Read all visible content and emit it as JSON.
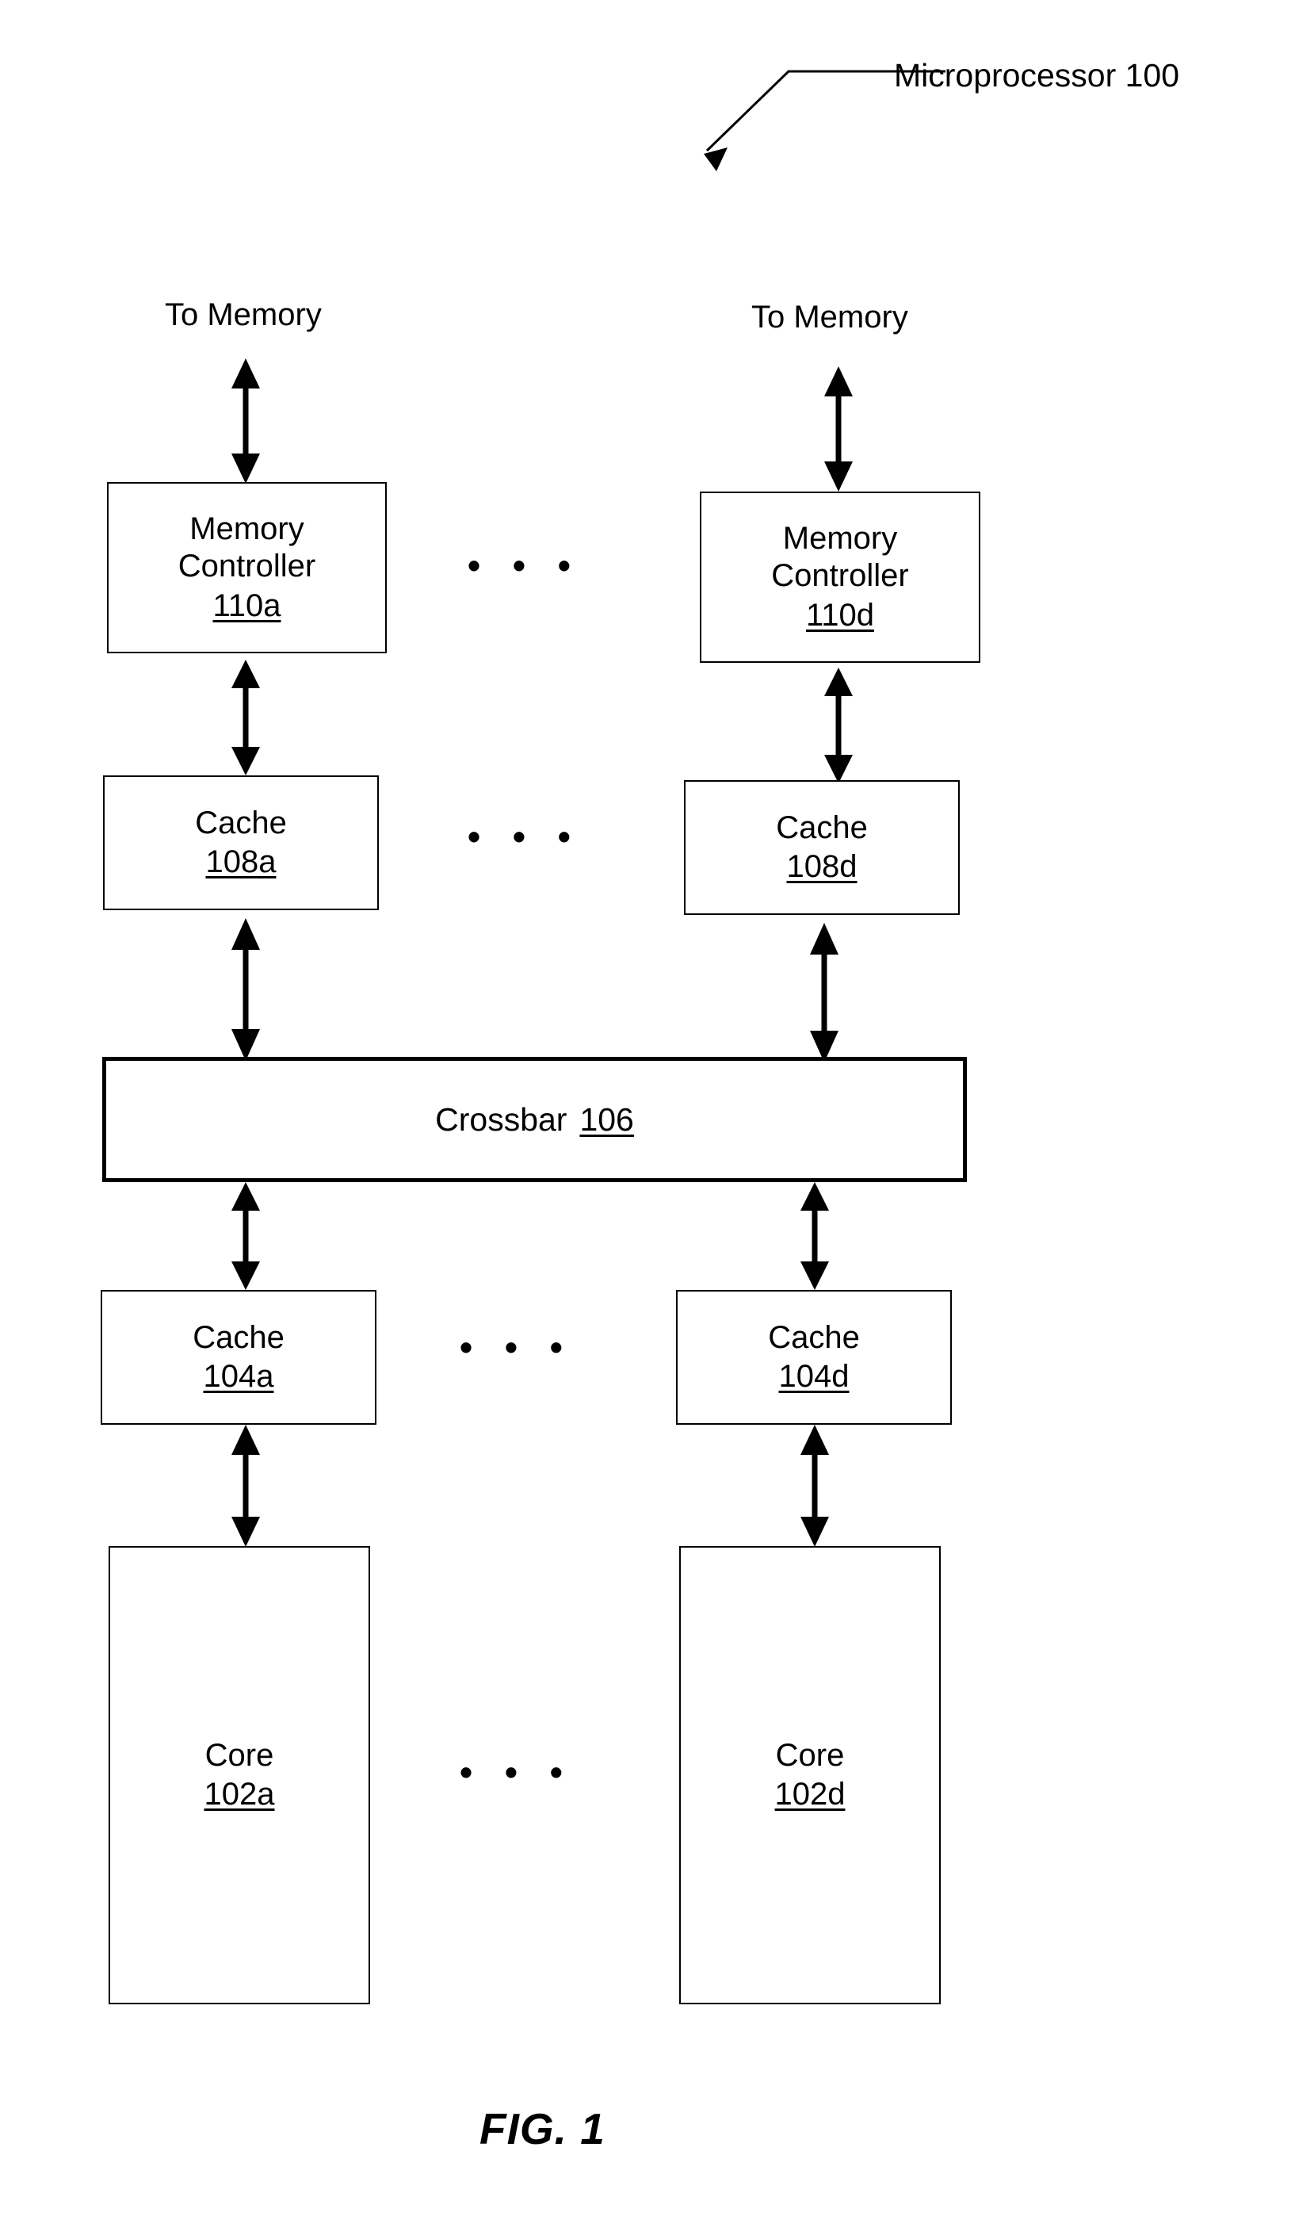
{
  "figure": {
    "caption": "FIG. 1",
    "title_callout": "Microprocessor 100"
  },
  "columns": {
    "left_suffix": "a",
    "right_suffix": "d"
  },
  "labels": {
    "to_memory_left": "To Memory",
    "to_memory_right": "To Memory",
    "ellipsis": "• • •"
  },
  "blocks": {
    "memory_controller_left": {
      "title": "Memory\nController",
      "ref": "110a"
    },
    "memory_controller_right": {
      "title": "Memory\nController",
      "ref": "110d"
    },
    "cache_upper_left": {
      "title": "Cache",
      "ref": "108a"
    },
    "cache_upper_right": {
      "title": "Cache",
      "ref": "108d"
    },
    "crossbar": {
      "title": "Crossbar",
      "ref": "106"
    },
    "cache_lower_left": {
      "title": "Cache",
      "ref": "104a"
    },
    "cache_lower_right": {
      "title": "Cache",
      "ref": "104d"
    },
    "core_left": {
      "title": "Core",
      "ref": "102a"
    },
    "core_right": {
      "title": "Core",
      "ref": "102d"
    }
  },
  "colors": {
    "stroke": "#000000",
    "background": "#ffffff"
  }
}
